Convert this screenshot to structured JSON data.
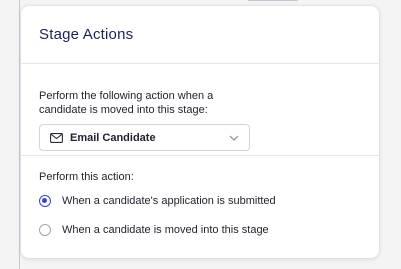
{
  "dialog": {
    "title": "Stage Actions",
    "trigger_label_line1": "Perform the following action when a",
    "trigger_label_line2": "candidate is moved into this stage:",
    "action_select": {
      "value": "Email Candidate",
      "icon": "mail-icon"
    },
    "timing_label": "Perform this action:",
    "options": [
      {
        "label": "When a candidate's application is submitted",
        "selected": true
      },
      {
        "label": "When a candidate is moved into this stage",
        "selected": false
      }
    ]
  },
  "colors": {
    "title": "#1f2256",
    "accent": "#3b3fe4",
    "border": "#e6e6ea"
  }
}
